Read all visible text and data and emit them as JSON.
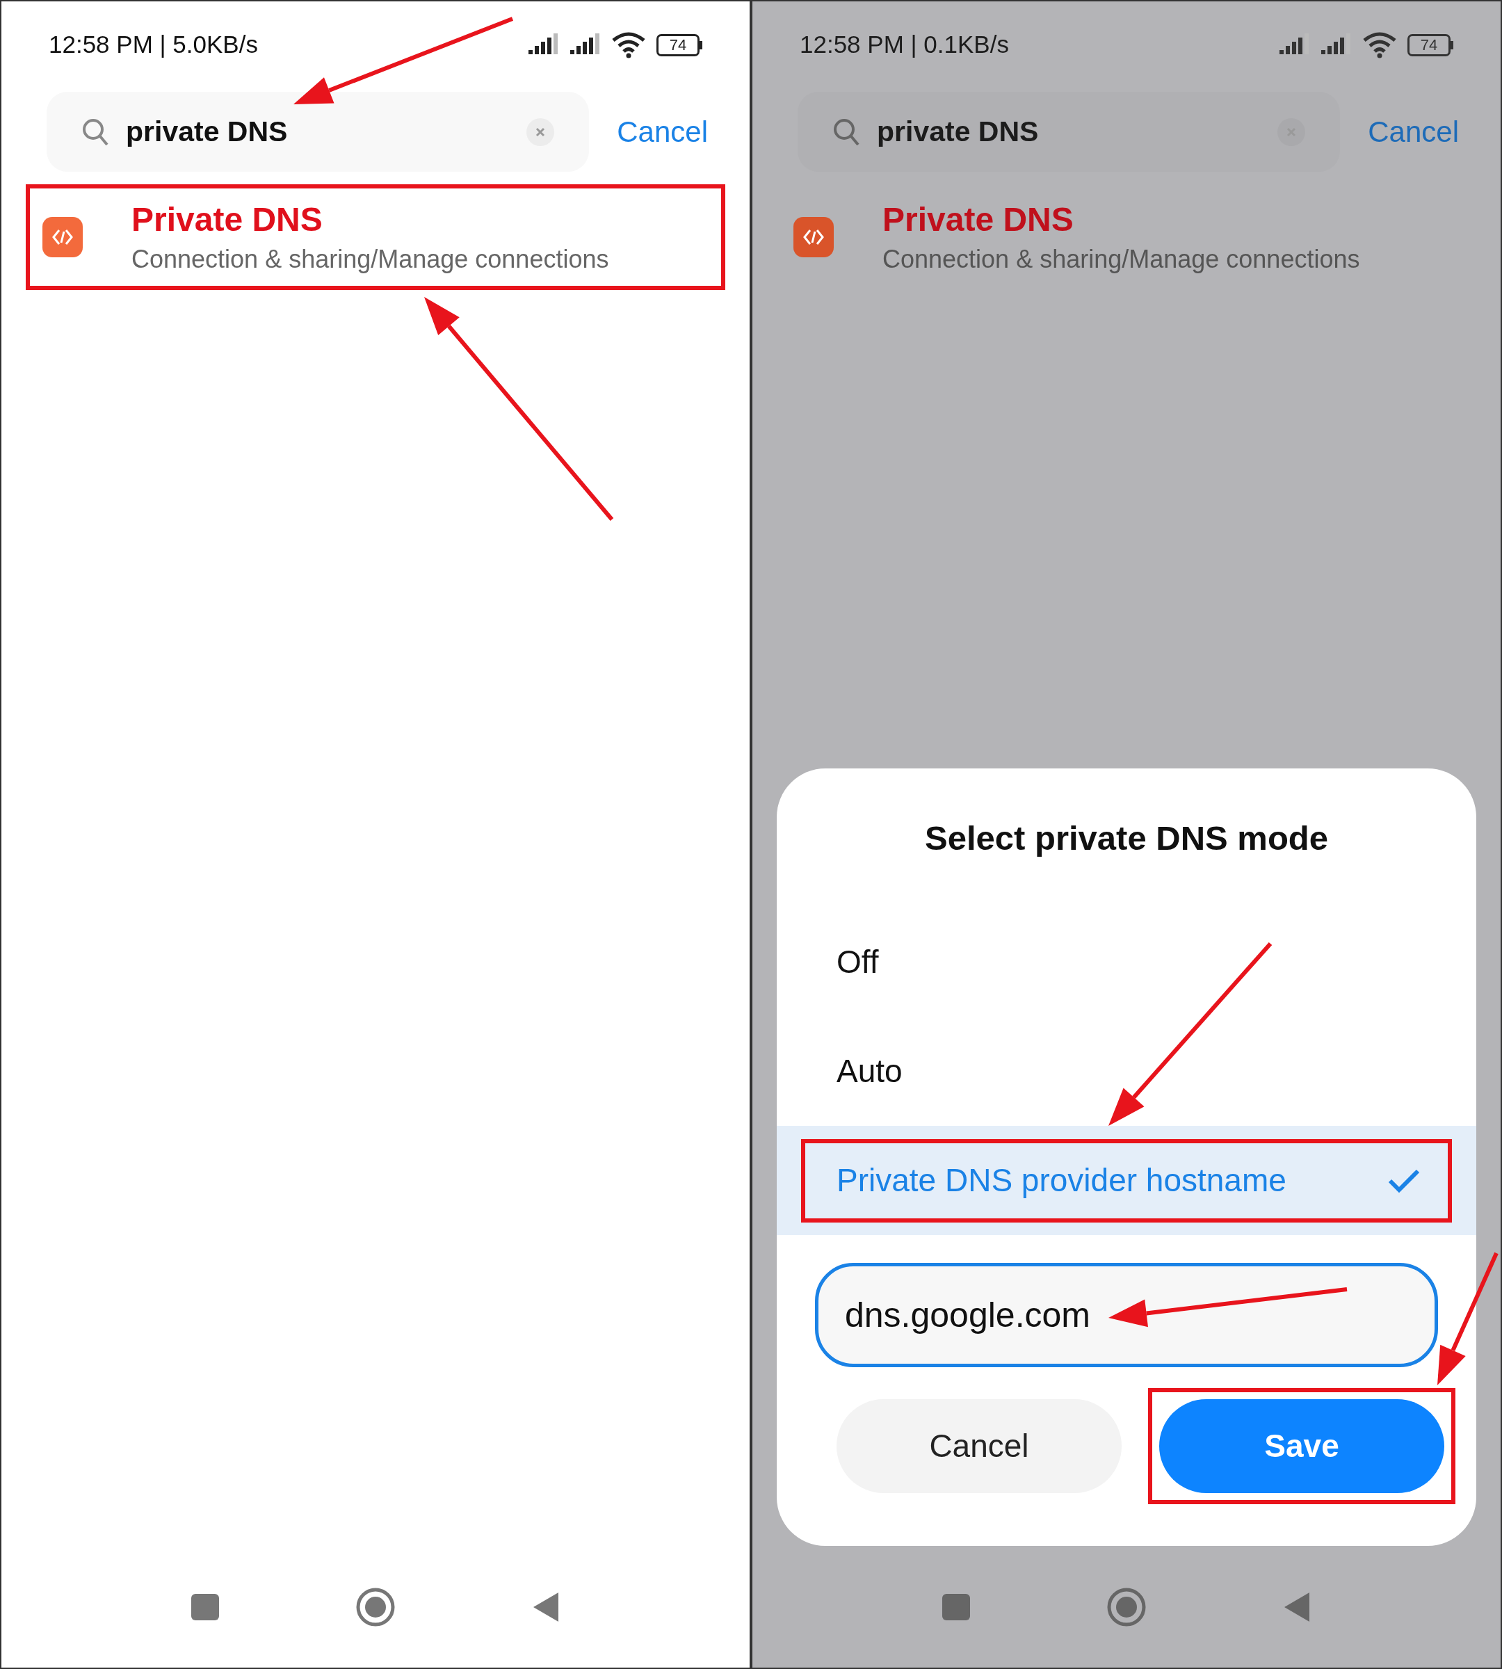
{
  "panels": [
    {
      "dimmed": false,
      "status_bar": {
        "time": "12:58 PM | 5.0KB/s",
        "battery": "74"
      },
      "search": {
        "value": "private DNS",
        "cancel": "Cancel"
      },
      "results": [
        {
          "title": "Private DNS",
          "path": "Connection & sharing/Manage connections",
          "highlighted": true
        }
      ]
    },
    {
      "dimmed": true,
      "status_bar": {
        "time": "12:58 PM | 0.1KB/s",
        "battery": "74"
      },
      "search": {
        "value": "private DNS",
        "cancel": "Cancel"
      },
      "results": [
        {
          "title": "Private DNS",
          "path": "Connection & sharing/Manage connections",
          "highlighted": false
        }
      ],
      "dialog": {
        "title": "Select private DNS mode",
        "options": [
          {
            "label": "Off",
            "selected": false,
            "highlighted": false
          },
          {
            "label": "Auto",
            "selected": false,
            "highlighted": false
          },
          {
            "label": "Private DNS provider hostname",
            "selected": true,
            "highlighted": true
          }
        ],
        "hostname": "dns.google.com",
        "buttons": [
          {
            "label": "Cancel",
            "kind": "secondary",
            "highlighted": false
          },
          {
            "label": "Save",
            "kind": "primary",
            "highlighted": true
          }
        ]
      }
    }
  ]
}
